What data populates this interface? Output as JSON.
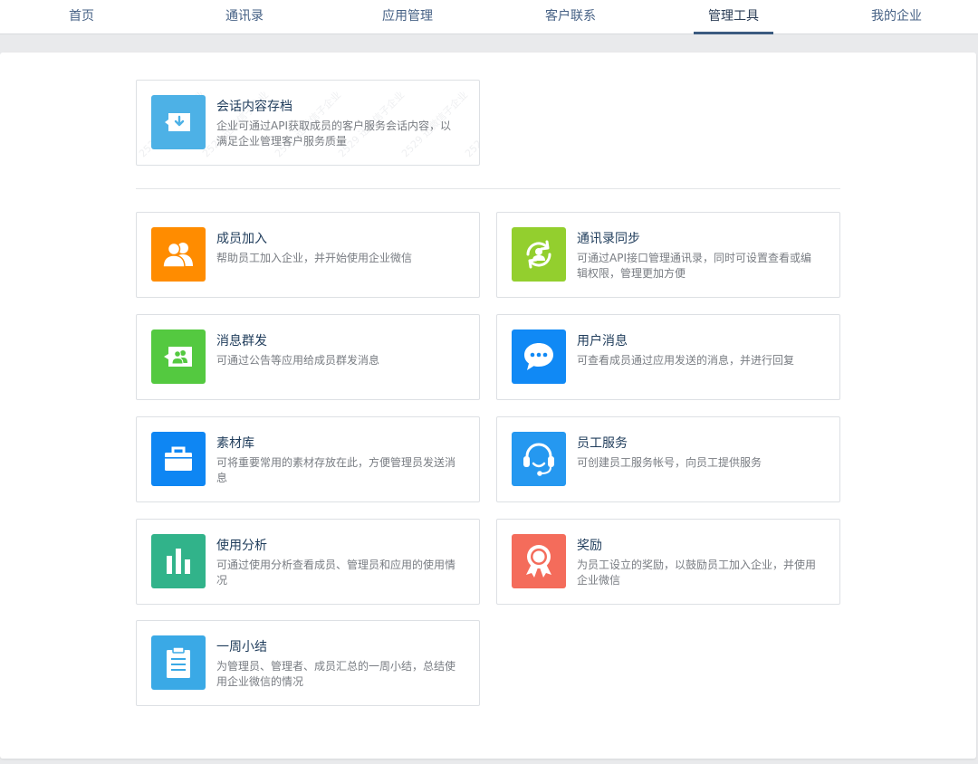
{
  "nav": {
    "tabs": [
      {
        "label": "首页"
      },
      {
        "label": "通讯录"
      },
      {
        "label": "应用管理"
      },
      {
        "label": "客户联系"
      },
      {
        "label": "管理工具"
      },
      {
        "label": "我的企业"
      }
    ],
    "active_index": 4
  },
  "featured": {
    "title": "会话内容存档",
    "desc": "企业可通过API获取成员的客户服务会话内容，以满足企业管理客户服务质量",
    "icon": "archive-download-icon",
    "color": "#4db1e6",
    "watermark": "2529 迅微信子企业"
  },
  "tools": [
    {
      "title": "成员加入",
      "desc": "帮助员工加入企业，并开始使用企业微信",
      "icon": "members-icon",
      "color": "#ff8c00"
    },
    {
      "title": "通讯录同步",
      "desc": "可通过API接口管理通讯录，同时可设置查看或编辑权限，管理更加方便",
      "icon": "sync-contact-icon",
      "color": "#93cf2e"
    },
    {
      "title": "消息群发",
      "desc": "可通过公告等应用给成员群发消息",
      "icon": "broadcast-icon",
      "color": "#54c940"
    },
    {
      "title": "用户消息",
      "desc": "可查看成员通过应用发送的消息，并进行回复",
      "icon": "chat-bubble-icon",
      "color": "#1089f5"
    },
    {
      "title": "素材库",
      "desc": "可将重要常用的素材存放在此，方便管理员发送消息",
      "icon": "briefcase-icon",
      "color": "#0e86f3"
    },
    {
      "title": "员工服务",
      "desc": "可创建员工服务帐号，向员工提供服务",
      "icon": "headset-icon",
      "color": "#2598f0"
    },
    {
      "title": "使用分析",
      "desc": "可通过使用分析查看成员、管理员和应用的使用情况",
      "icon": "bar-chart-icon",
      "color": "#31b38a"
    },
    {
      "title": "奖励",
      "desc": "为员工设立的奖励，以鼓励员工加入企业，并使用企业微信",
      "icon": "award-icon",
      "color": "#f46c5b"
    },
    {
      "title": "一周小结",
      "desc": "为管理员、管理者、成员汇总的一周小结，总结使用企业微信的情况",
      "icon": "clipboard-icon",
      "color": "#3aa9e6"
    }
  ]
}
